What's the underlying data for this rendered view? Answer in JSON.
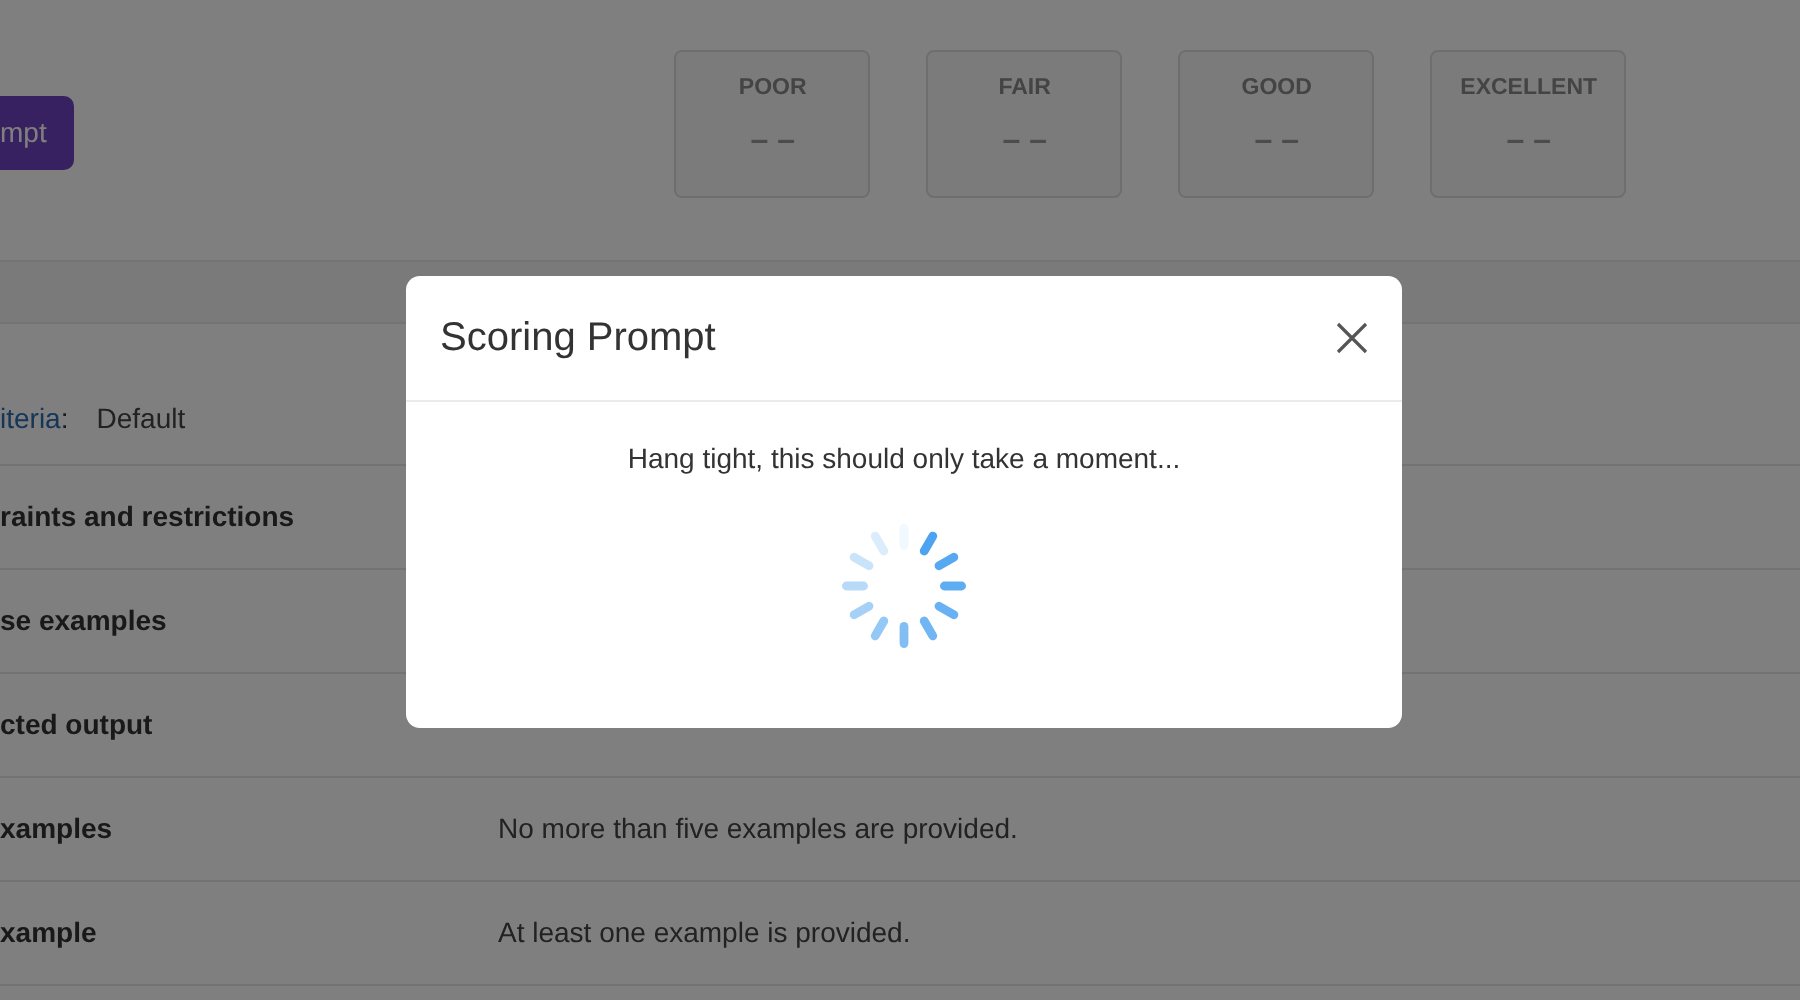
{
  "action_button": {
    "label": "mpt"
  },
  "score_cards": [
    {
      "label": "POOR",
      "value": "– –"
    },
    {
      "label": "FAIR",
      "value": "– –"
    },
    {
      "label": "GOOD",
      "value": "– –"
    },
    {
      "label": "EXCELLENT",
      "value": "– –"
    }
  ],
  "criteria": {
    "label": "iteria",
    "separator": ":",
    "value": "Default"
  },
  "rows": [
    {
      "label": "raints and restrictions"
    },
    {
      "label": "se examples"
    },
    {
      "label": "cted output"
    },
    {
      "label": "xamples",
      "description": "No more than five examples are provided."
    },
    {
      "label": "xample",
      "description": "At least one example is provided."
    }
  ],
  "modal": {
    "title": "Scoring Prompt",
    "message": "Hang tight, this should only take a moment...",
    "loading": true
  }
}
